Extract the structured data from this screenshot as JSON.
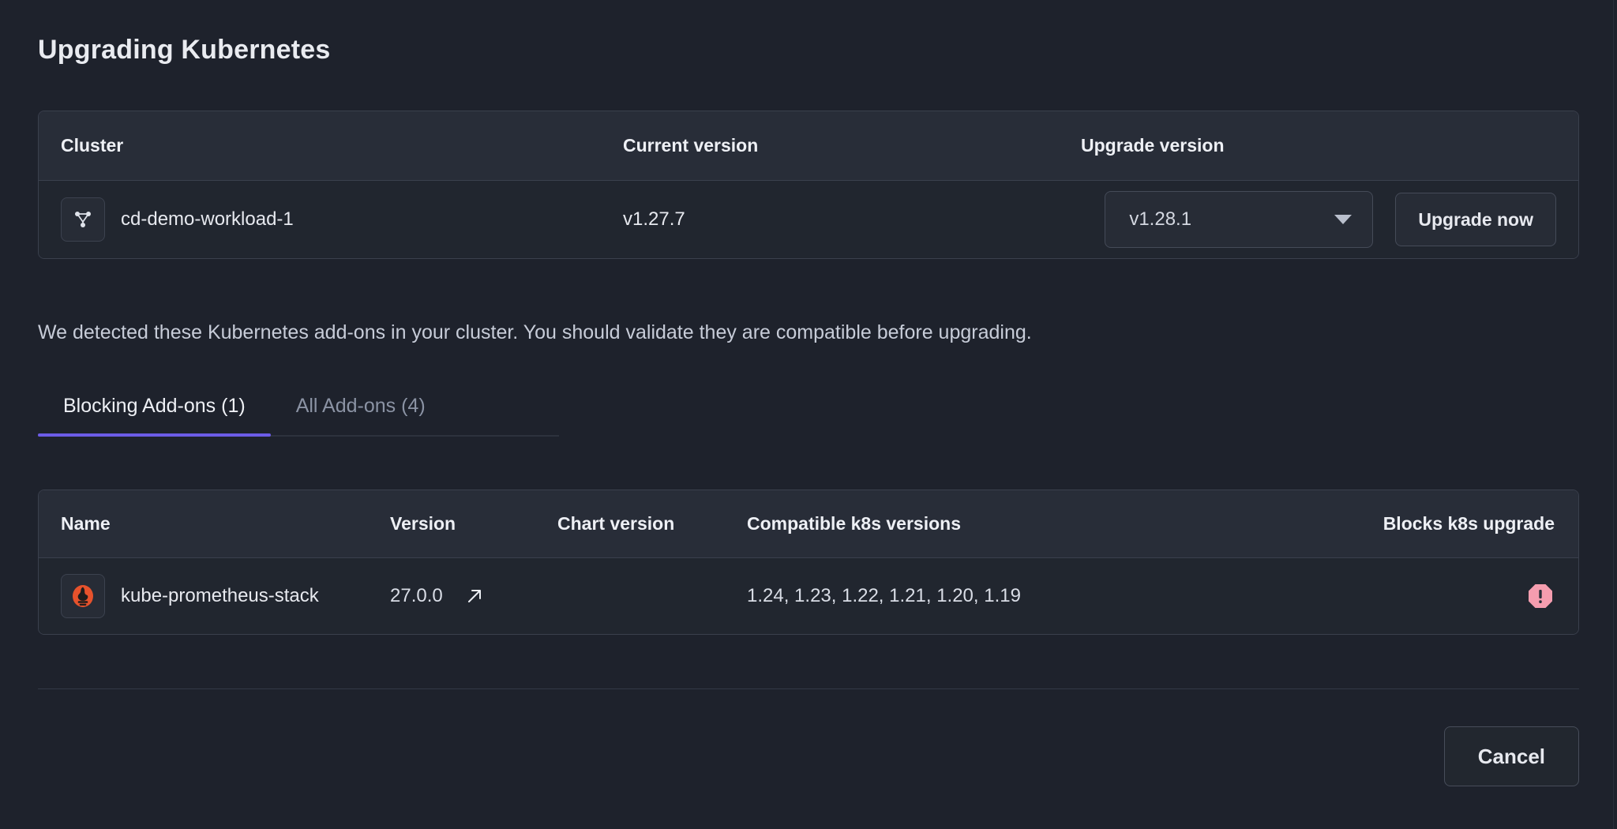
{
  "page": {
    "title": "Upgrading Kubernetes",
    "description": "We detected these Kubernetes add-ons in your cluster. You should validate they are compatible before upgrading."
  },
  "cluster_table": {
    "headers": {
      "cluster": "Cluster",
      "current_version": "Current version",
      "upgrade_version": "Upgrade version"
    },
    "row": {
      "icon": "cluster-nodes-icon",
      "name": "cd-demo-workload-1",
      "current_version": "v1.27.7",
      "upgrade_version_selected": "v1.28.1",
      "upgrade_button_label": "Upgrade now",
      "dropdown_icon": "chevron-down-icon"
    }
  },
  "tabs": [
    {
      "label": "Blocking Add-ons (1)",
      "active": true
    },
    {
      "label": "All Add-ons (4)",
      "active": false
    }
  ],
  "addons_table": {
    "headers": {
      "name": "Name",
      "version": "Version",
      "chart_version": "Chart version",
      "compatible": "Compatible k8s versions",
      "blocks": "Blocks k8s upgrade"
    },
    "rows": [
      {
        "icon": "prometheus-icon",
        "name": "kube-prometheus-stack",
        "version": "27.0.0",
        "external_link_icon": "external-link-icon",
        "chart_version": "",
        "compatible": "1.24, 1.23, 1.22, 1.21, 1.20, 1.19",
        "blocks_icon": "alert-octagon-icon"
      }
    ]
  },
  "footer": {
    "cancel_label": "Cancel"
  },
  "colors": {
    "background": "#1e222c",
    "surface": "#21262f",
    "header_surface": "#282d38",
    "border": "#3a404d",
    "accent": "#6c5ce7",
    "warning": "#f59daf",
    "prometheus_orange": "#e6522c",
    "text_primary": "#e7e9ef",
    "text_muted": "#8b93a4"
  }
}
